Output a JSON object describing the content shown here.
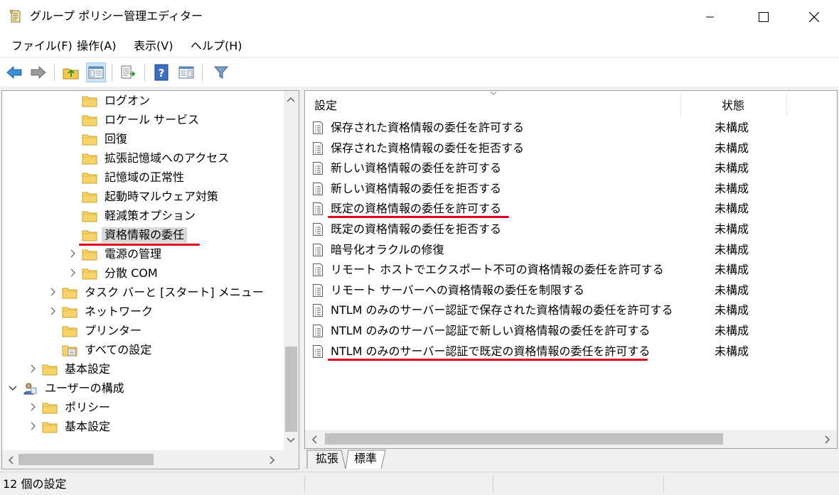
{
  "window": {
    "title": "グループ ポリシー管理エディター"
  },
  "menu": [
    "ファイル(F)",
    "操作(A)",
    "表示(V)",
    "ヘルプ(H)"
  ],
  "toolbar": {
    "icons": [
      "back-icon",
      "forward-icon",
      "up-folder-icon",
      "show-hide-tree-icon",
      "export-list-icon",
      "help-icon",
      "action-pane-icon",
      "filter-icon"
    ]
  },
  "tree": {
    "items": [
      {
        "label": "ログオン",
        "level": 3,
        "expander": "none",
        "icon": "folder-icon"
      },
      {
        "label": "ロケール サービス",
        "level": 3,
        "expander": "none",
        "icon": "folder-icon"
      },
      {
        "label": "回復",
        "level": 3,
        "expander": "none",
        "icon": "folder-icon"
      },
      {
        "label": "拡張記憶域へのアクセス",
        "level": 3,
        "expander": "none",
        "icon": "folder-icon"
      },
      {
        "label": "記憶域の正常性",
        "level": 3,
        "expander": "none",
        "icon": "folder-icon"
      },
      {
        "label": "起動時マルウェア対策",
        "level": 3,
        "expander": "none",
        "icon": "folder-icon"
      },
      {
        "label": "軽減策オプション",
        "level": 3,
        "expander": "none",
        "icon": "folder-icon"
      },
      {
        "label": "資格情報の委任",
        "level": 3,
        "expander": "none",
        "icon": "folder-icon",
        "selected": true
      },
      {
        "label": "電源の管理",
        "level": 3,
        "expander": "collapsed",
        "icon": "folder-icon"
      },
      {
        "label": "分散 COM",
        "level": 3,
        "expander": "collapsed",
        "icon": "folder-icon"
      },
      {
        "label": "タスク バーと [スタート] メニュー",
        "level": 2,
        "expander": "collapsed",
        "icon": "folder-icon"
      },
      {
        "label": "ネットワーク",
        "level": 2,
        "expander": "collapsed",
        "icon": "folder-icon"
      },
      {
        "label": "プリンター",
        "level": 2,
        "expander": "none",
        "icon": "folder-icon"
      },
      {
        "label": "すべての設定",
        "level": 2,
        "expander": "none",
        "icon": "settings-folder-icon"
      },
      {
        "label": "基本設定",
        "level": 1,
        "expander": "collapsed",
        "icon": "folder-icon"
      },
      {
        "label": "ユーザーの構成",
        "level": 0,
        "expander": "expanded",
        "icon": "user-config-icon"
      },
      {
        "label": "ポリシー",
        "level": 1,
        "expander": "collapsed",
        "icon": "folder-icon"
      },
      {
        "label": "基本設定",
        "level": 1,
        "expander": "collapsed",
        "icon": "folder-icon"
      }
    ]
  },
  "detail": {
    "columns": {
      "setting": "設定",
      "state": "状態"
    },
    "rows": [
      {
        "name": "保存された資格情報の委任を許可する",
        "state": "未構成"
      },
      {
        "name": "保存された資格情報の委任を拒否する",
        "state": "未構成"
      },
      {
        "name": "新しい資格情報の委任を許可する",
        "state": "未構成"
      },
      {
        "name": "新しい資格情報の委任を拒否する",
        "state": "未構成"
      },
      {
        "name": "既定の資格情報の委任を許可する",
        "state": "未構成",
        "highlighted": true
      },
      {
        "name": "既定の資格情報の委任を拒否する",
        "state": "未構成"
      },
      {
        "name": "暗号化オラクルの修復",
        "state": "未構成"
      },
      {
        "name": "リモート ホストでエクスポート不可の資格情報の委任を許可する",
        "state": "未構成"
      },
      {
        "name": "リモート サーバーへの資格情報の委任を制限する",
        "state": "未構成"
      },
      {
        "name": "NTLM のみのサーバー認証で保存された資格情報の委任を許可する",
        "state": "未構成"
      },
      {
        "name": "NTLM のみのサーバー認証で新しい資格情報の委任を許可する",
        "state": "未構成"
      },
      {
        "name": "NTLM のみのサーバー認証で既定の資格情報の委任を許可する",
        "state": "未構成",
        "highlighted": true
      }
    ]
  },
  "tabs": [
    "拡張",
    "標準"
  ],
  "active_tab": "標準",
  "status": {
    "text": "12 個の設定"
  },
  "colors": {
    "highlight_underline": "#e0001b",
    "selection": "#d9d9d9",
    "folder": "#f6d36b"
  }
}
